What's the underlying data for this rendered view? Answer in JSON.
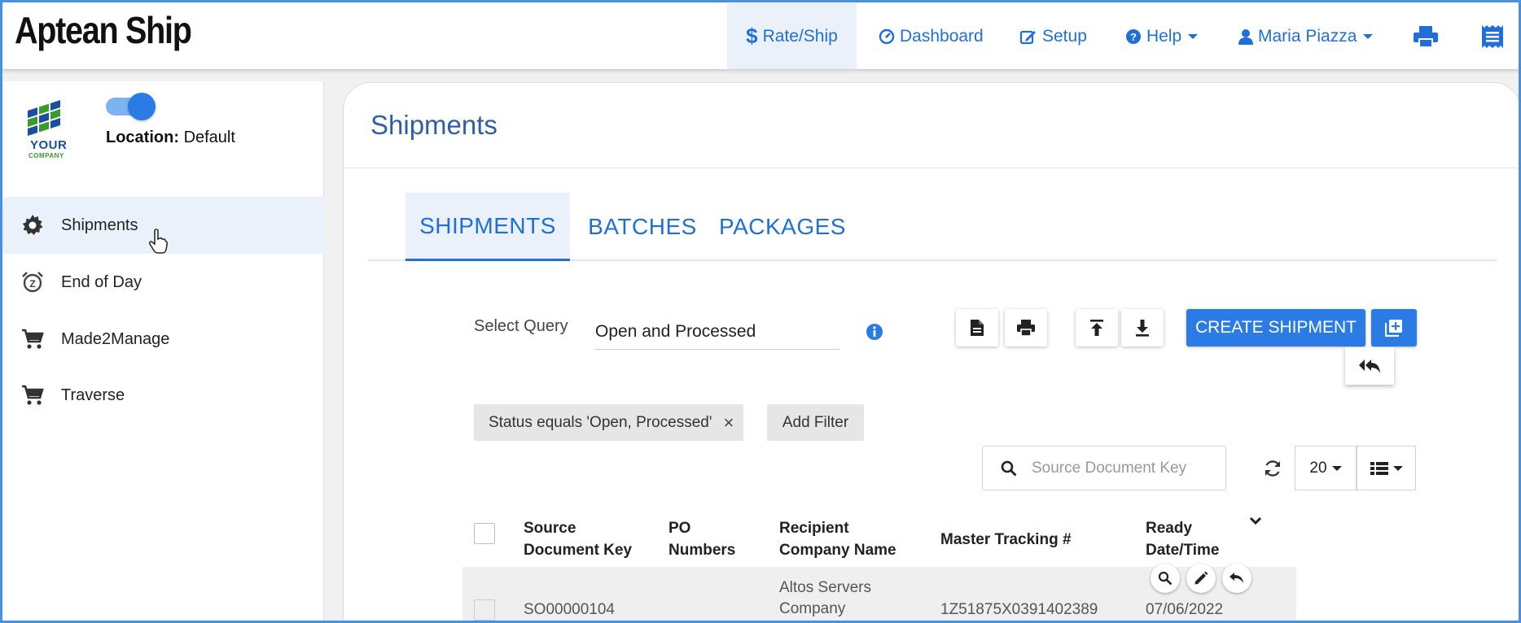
{
  "app": {
    "brand": "Aptean Ship"
  },
  "nav": {
    "rate_ship": "Rate/Ship",
    "dashboard": "Dashboard",
    "setup": "Setup",
    "help": "Help",
    "user": "Maria Piazza"
  },
  "sidebar": {
    "logo_line1": "YOUR",
    "logo_line2": "COMPANY",
    "location_label": "Location:",
    "location_value": "Default",
    "items": [
      {
        "label": "Shipments",
        "icon": "gear-icon"
      },
      {
        "label": "End of Day",
        "icon": "alarm-snooze-icon"
      },
      {
        "label": "Made2Manage",
        "icon": "cart-icon"
      },
      {
        "label": "Traverse",
        "icon": "cart-icon"
      }
    ]
  },
  "main": {
    "title": "Shipments",
    "tabs": [
      "SHIPMENTS",
      "BATCHES",
      "PACKAGES"
    ],
    "query_label": "Select Query",
    "query_value": "Open and Processed",
    "create_label": "CREATE SHIPMENT",
    "filter_chip": "Status equals 'Open, Processed'",
    "filter_remove": "×",
    "add_filter": "Add Filter",
    "search_placeholder": "Source Document Key",
    "page_size": "20"
  },
  "table": {
    "headers": {
      "source_key_1": "Source",
      "source_key_2": "Document Key",
      "po_1": "PO",
      "po_2": "Numbers",
      "recipient_1": "Recipient",
      "recipient_2": "Company Name",
      "tracking": "Master Tracking #",
      "ready_1": "Ready",
      "ready_2": "Date/Time"
    },
    "rows": [
      {
        "source_key": "SO00000104",
        "po": "",
        "recipient_1": "Altos Servers",
        "recipient_2": "Company",
        "tracking": "1Z51875X0391402389",
        "ready": "07/06/2022"
      }
    ]
  },
  "colors": {
    "accent": "#2a7be4",
    "link": "#1f6fdb",
    "title": "#2e5fa7",
    "active_bg": "#eaf1fb"
  }
}
